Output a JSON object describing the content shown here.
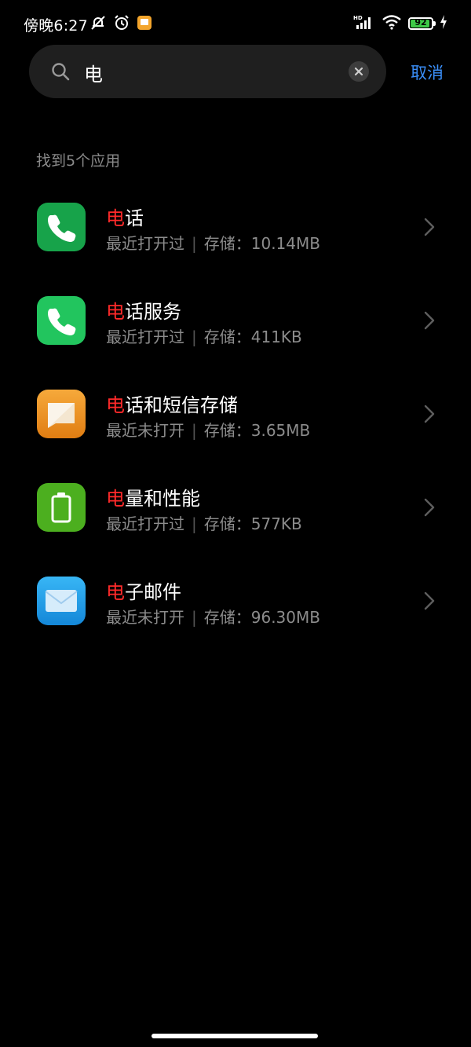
{
  "status_bar": {
    "time": "傍晚6:27",
    "hd_label": "HD",
    "battery_level": "92",
    "battery_percent": 92,
    "battery_color": "#3ec947"
  },
  "search": {
    "query": "电",
    "cancel_label": "取消"
  },
  "results": {
    "header": "找到5个应用",
    "items": [
      {
        "highlight": "电",
        "name_rest": "话",
        "status": "最近打开过",
        "storage_label": "存储：",
        "storage": "10.14MB",
        "icon": "phone-icon"
      },
      {
        "highlight": "电",
        "name_rest": "话服务",
        "status": "最近打开过",
        "storage_label": "存储：",
        "storage": "411KB",
        "icon": "phone-services-icon"
      },
      {
        "highlight": "电",
        "name_rest": "话和短信存储",
        "status": "最近未打开",
        "storage_label": "存储：",
        "storage": "3.65MB",
        "icon": "message-storage-icon"
      },
      {
        "highlight": "电",
        "name_rest": "量和性能",
        "status": "最近打开过",
        "storage_label": "存储：",
        "storage": "577KB",
        "icon": "battery-performance-icon"
      },
      {
        "highlight": "电",
        "name_rest": "子邮件",
        "status": "最近未打开",
        "storage_label": "存储：",
        "storage": "96.30MB",
        "icon": "email-icon"
      }
    ]
  },
  "colors": {
    "accent": "#3a8ef7",
    "highlight": "#ff2a2a",
    "background": "#000000"
  }
}
